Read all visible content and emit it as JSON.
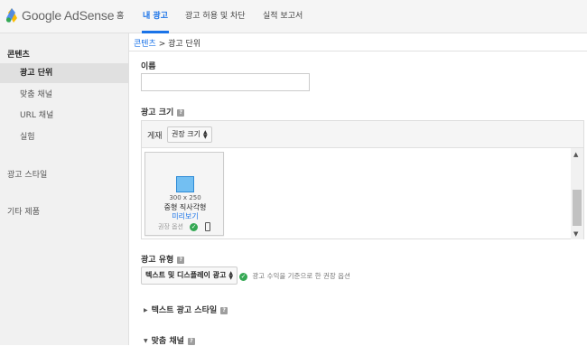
{
  "app": {
    "logo_text": "Google AdSense"
  },
  "nav": {
    "home": "홈",
    "my_ads": "내 광고",
    "allow_block": "광고 허용 및 차단",
    "reports": "실적 보고서"
  },
  "sidebar": {
    "content_heading": "콘텐츠",
    "items": [
      {
        "label": "광고 단위",
        "selected": true
      },
      {
        "label": "맞춤 채널",
        "selected": false
      },
      {
        "label": "URL 채널",
        "selected": false
      },
      {
        "label": "실험",
        "selected": false
      }
    ],
    "ad_style": "광고 스타일",
    "other_products": "기타 제품"
  },
  "breadcrumb": {
    "link": "콘텐츠",
    "separator": ">",
    "current": "광고 단위"
  },
  "form": {
    "name_label": "이름",
    "name_value": "",
    "size_label": "광고 크기",
    "placement_label": "게재",
    "size_select": "권장 크기",
    "card": {
      "dimensions": "300 x 250",
      "name": "중형 직사각형",
      "preview_link": "미리보기",
      "recommended": "권장 옵션"
    },
    "type_label": "광고 유형",
    "type_select": "텍스트 및 디스플레이 광고",
    "type_hint": "광고 수익을 기준으로 한 권장 옵션",
    "text_style_label": "텍스트 광고 스타일",
    "custom_channels_label": "맞춤 채널"
  },
  "colors": {
    "accent": "#1a73e8",
    "ok": "#34a853",
    "ad_preview": "#73bff2"
  },
  "icons": [
    "adsense-logo-icon",
    "help-icon",
    "check-circle-icon",
    "mobile-icon",
    "chevron-up-icon",
    "chevron-down-icon",
    "triangle-right-icon",
    "triangle-down-icon"
  ]
}
